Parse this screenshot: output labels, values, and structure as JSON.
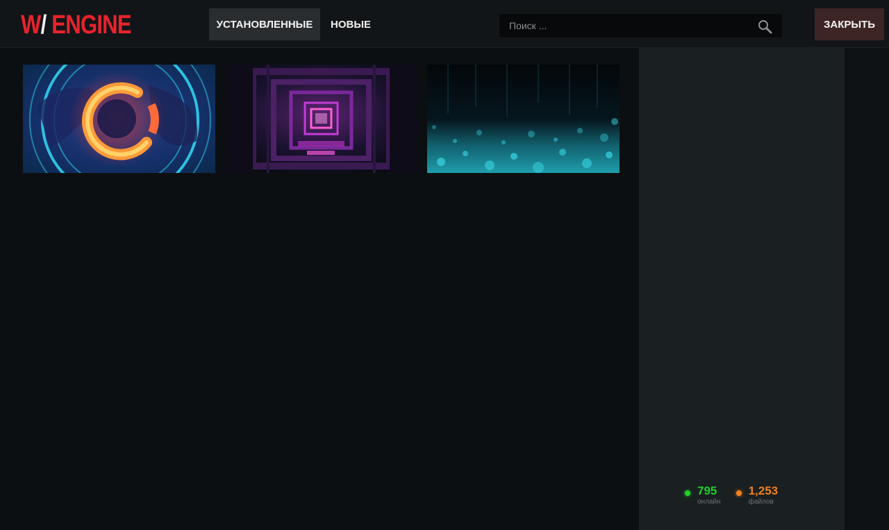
{
  "header": {
    "logo_prefix": "W",
    "logo_slash": "/",
    "logo_name": "ENGINE",
    "tabs": [
      {
        "label": "УСТАНОВЛЕННЫЕ",
        "active": true
      },
      {
        "label": "НОВЫЕ",
        "active": false
      }
    ],
    "search": {
      "placeholder": "Поиск ...",
      "icon": "search-icon"
    },
    "close_label": "ЗАКРЫТЬ"
  },
  "wallpapers": [
    {
      "name": "neon-ring",
      "palette": [
        "#1a2f6a",
        "#2fe0ff",
        "#ff5a2a",
        "#ffb24a"
      ]
    },
    {
      "name": "neon-corridor",
      "palette": [
        "#120a20",
        "#c23bd0",
        "#ff5fcf",
        "#2a1640"
      ]
    },
    {
      "name": "cyan-particles",
      "palette": [
        "#02060a",
        "#23c7d9",
        "#2f9fb0",
        "#0a2733"
      ]
    }
  ],
  "stats": {
    "online": {
      "value": "795",
      "label": "онлайн",
      "color": "#1fd12a"
    },
    "files": {
      "value": "1,253",
      "label": "файлов",
      "color": "#f2801e"
    }
  },
  "colors": {
    "brand": "#e8232c",
    "close_button": "#3d2425",
    "active_tab": "#2a2d30"
  }
}
